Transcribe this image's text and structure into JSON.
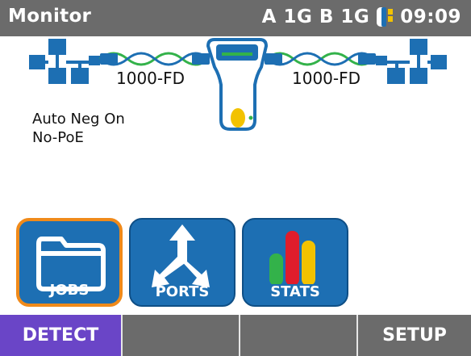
{
  "status_bar": {
    "title": "Monitor",
    "port_status": "A 1G B 1G",
    "time": "09:09",
    "battery_icon": "battery-icon",
    "colors": {
      "bar": "#6b6b6b",
      "battery_level": "#f2c200"
    }
  },
  "link": {
    "left_speed": "1000-FD",
    "right_speed": "1000-FD"
  },
  "info": {
    "negotiation": "Auto Neg On",
    "poe": "No-PoE"
  },
  "tiles": [
    {
      "label": "JOBS",
      "icon": "folder-icon"
    },
    {
      "label": "PORTS",
      "icon": "ports-arrows-icon"
    },
    {
      "label": "STATS",
      "icon": "bar-chart-icon"
    }
  ],
  "softkeys": [
    "DETECT",
    "",
    "",
    "SETUP"
  ],
  "colors": {
    "tile": "#1d6fb3",
    "tile_selected_border": "#f08a1a",
    "softkey_active": "#6a45c7",
    "link_green": "#33b24a",
    "network_blue": "#1d6fb3"
  }
}
